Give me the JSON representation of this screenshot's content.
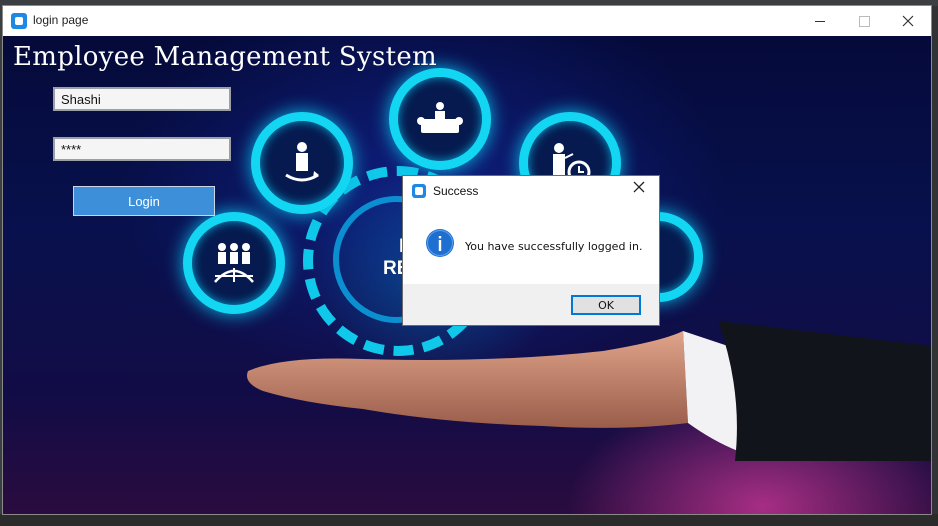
{
  "window": {
    "title": "login page"
  },
  "header": {
    "app_title": "Employee Management System"
  },
  "form": {
    "username_value": "Shashi",
    "password_value": "****",
    "login_label": "Login"
  },
  "background": {
    "partial_text_1": "I",
    "partial_text_2": "RE"
  },
  "dialog": {
    "title": "Success",
    "message": "You have successfully logged in.",
    "ok_label": "OK"
  },
  "colors": {
    "accent": "#3d8fd9",
    "neon": "#13d6f2",
    "dialog_focus": "#0078d7"
  }
}
